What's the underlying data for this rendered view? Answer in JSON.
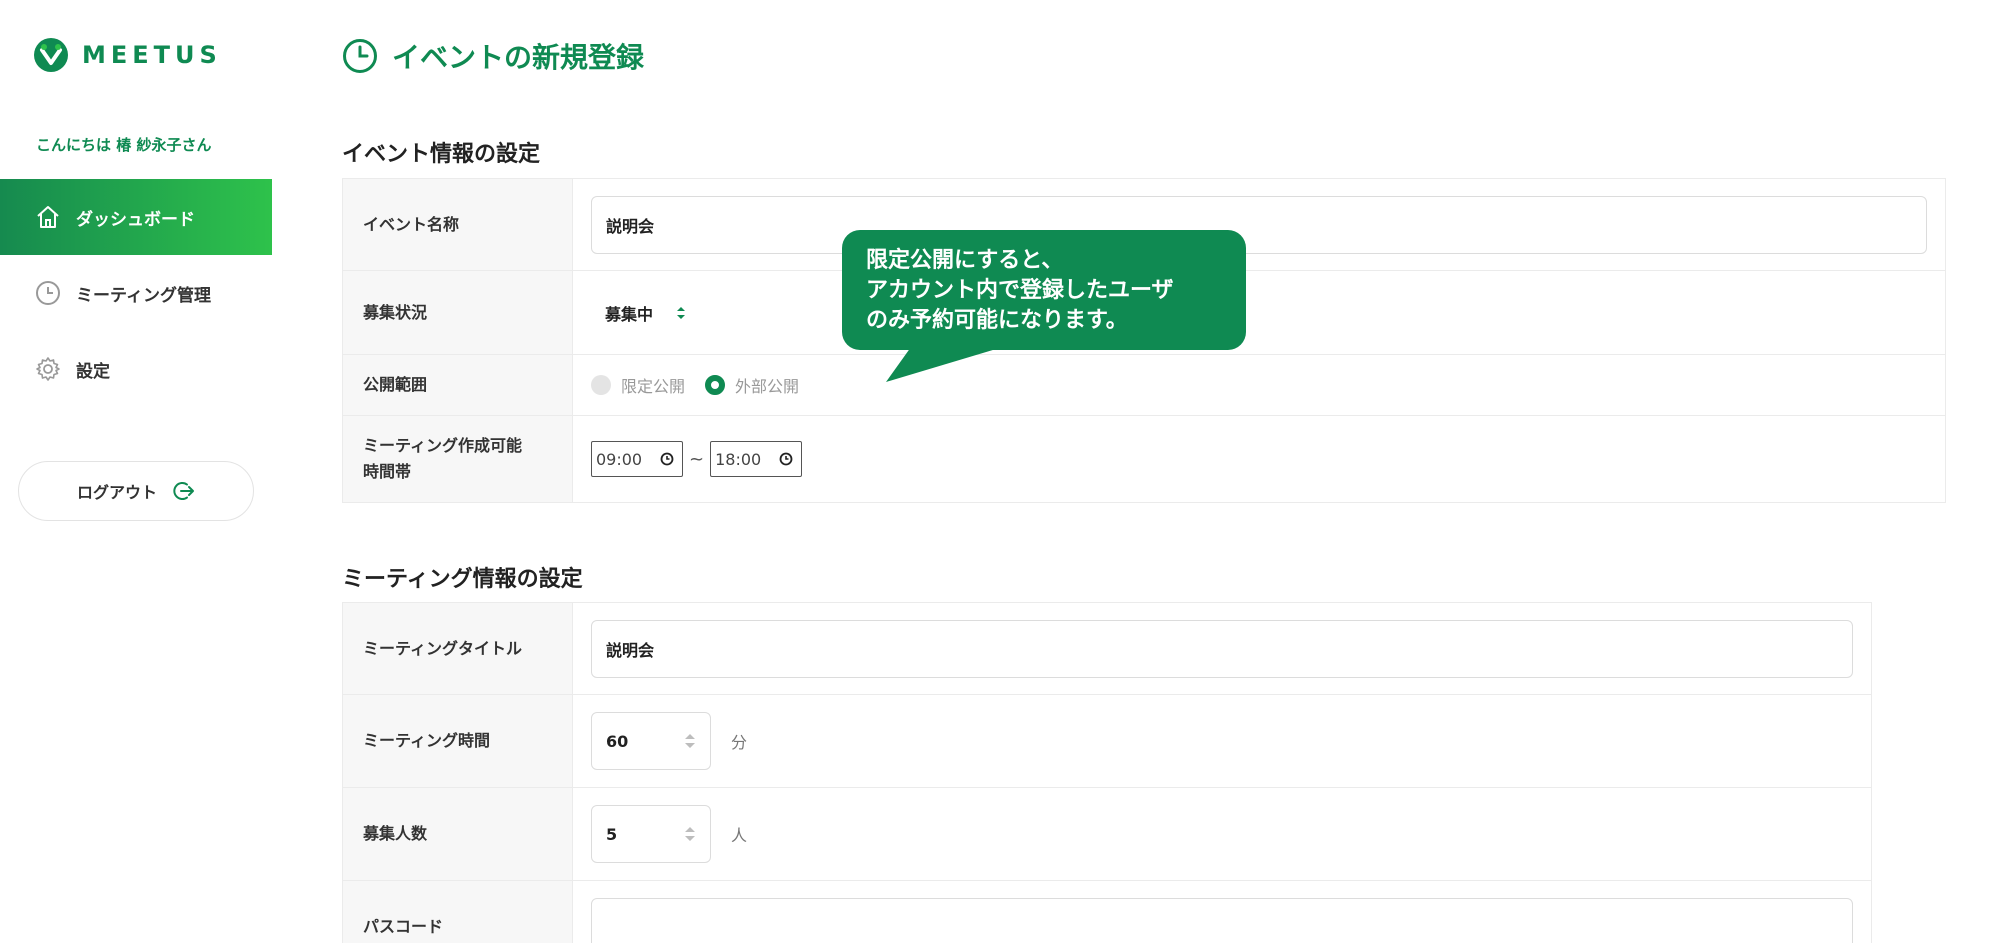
{
  "brand": {
    "name": "MEETUS",
    "accent": "#0f8a52",
    "accent_light": "#2ec24b"
  },
  "sidebar": {
    "greeting": "こんにちは 椿 紗永子さん",
    "items": [
      {
        "label": "ダッシュボード",
        "icon": "home-icon",
        "active": true
      },
      {
        "label": "ミーティング管理",
        "icon": "clock-icon",
        "active": false
      },
      {
        "label": "設定",
        "icon": "gear-icon",
        "active": false
      }
    ],
    "logout_label": "ログアウト"
  },
  "page": {
    "title": "イベントの新規登録"
  },
  "event_section": {
    "title": "イベント情報の設定",
    "rows": {
      "name": {
        "label": "イベント名称",
        "value": "説明会"
      },
      "status": {
        "label": "募集状況",
        "value": "募集中"
      },
      "visibility": {
        "label": "公開範囲",
        "options": [
          "限定公開",
          "外部公開"
        ],
        "selected": "外部公開"
      },
      "hours": {
        "label_line1": "ミーティング作成可能",
        "label_line2": "時間帯",
        "start": "09:00",
        "separator": "~",
        "end": "18:00"
      }
    }
  },
  "meeting_section": {
    "title": "ミーティング情報の設定",
    "rows": {
      "title": {
        "label": "ミーティングタイトル",
        "value": "説明会"
      },
      "duration": {
        "label": "ミーティング時間",
        "value": "60",
        "unit": "分"
      },
      "capacity": {
        "label": "募集人数",
        "value": "5",
        "unit": "人"
      },
      "passcode": {
        "label": "パスコード",
        "value": ""
      }
    }
  },
  "tooltip": {
    "line1": "限定公開にすると、",
    "line2": "アカウント内で登録したユーザ",
    "line3": "のみ予約可能になります。"
  }
}
